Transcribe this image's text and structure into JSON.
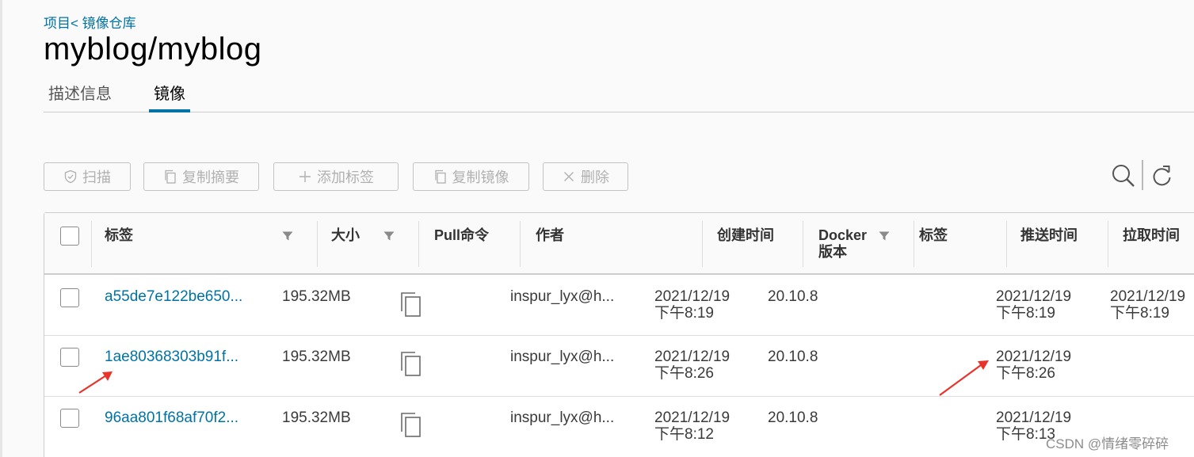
{
  "breadcrumb": "项目< 镜像仓库",
  "page_title": "myblog/myblog",
  "tabs": [
    {
      "label": "描述信息",
      "active": false
    },
    {
      "label": "镜像",
      "active": true
    }
  ],
  "toolbar": {
    "scan": "扫描",
    "copy_digest": "复制摘要",
    "add_label": "添加标签",
    "copy_image": "复制镜像",
    "delete": "删除",
    "icons": [
      "shield-icon",
      "copy-icon",
      "plus-icon",
      "copy-icon",
      "close-icon",
      "search-icon",
      "refresh-icon"
    ]
  },
  "columns": {
    "tag": "标签",
    "size": "大小",
    "pull": "Pull命令",
    "author": "作者",
    "created": "创建时间",
    "docker_line1": "Docker",
    "docker_line2": "版本",
    "labels": "标签",
    "pushed": "推送时间",
    "pulled": "拉取时间"
  },
  "rows": [
    {
      "tag": "a55de7e122be650...",
      "size": "195.32MB",
      "author": "inspur_lyx@h...",
      "created_date": "2021/12/19",
      "created_time": "下午8:19",
      "docker": "20.10.8",
      "pushed_date": "2021/12/19",
      "pushed_time": "下午8:19",
      "pulled_date": "2021/12/19",
      "pulled_time": "下午8:19"
    },
    {
      "tag": "1ae80368303b91f...",
      "size": "195.32MB",
      "author": "inspur_lyx@h...",
      "created_date": "2021/12/19",
      "created_time": "下午8:26",
      "docker": "20.10.8",
      "pushed_date": "2021/12/19",
      "pushed_time": "下午8:26",
      "pulled_date": "",
      "pulled_time": ""
    },
    {
      "tag": "96aa801f68af70f2...",
      "size": "195.32MB",
      "author": "inspur_lyx@h...",
      "created_date": "2021/12/19",
      "created_time": "下午8:12",
      "docker": "20.10.8",
      "pushed_date": "2021/12/19",
      "pushed_time": "下午8:13",
      "pulled_date": "",
      "pulled_time": ""
    }
  ],
  "colors": {
    "accent": "#0072a3",
    "annotation_arrow": "#e8332a"
  },
  "watermark": "CSDN @情绪零碎碎"
}
